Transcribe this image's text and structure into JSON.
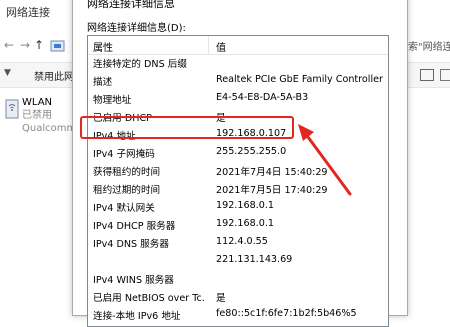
{
  "explorer": {
    "title": "网络连接",
    "nav": {
      "back": "←",
      "forward": "→",
      "up": "↑"
    },
    "search_placeholder": "搜索\"网络连",
    "toolbar": {
      "disable_label": "禁用此网",
      "left_chevron": "▼",
      "right_chevron": "»"
    },
    "adapter": {
      "name": "WLAN",
      "status": "已禁用",
      "device": "Qualcomm"
    }
  },
  "dialog": {
    "title": "网络连接详细信息",
    "section_label": "网络连接详细信息(D):",
    "columns": {
      "property": "属性",
      "value": "值"
    },
    "rows": [
      {
        "property": "连接特定的 DNS 后缀",
        "value": ""
      },
      {
        "property": "描述",
        "value": "Realtek PCIe GbE Family Controller"
      },
      {
        "property": "物理地址",
        "value": "E4-54-E8-DA-5A-B3"
      },
      {
        "property": "已启用 DHCP",
        "value": "是"
      },
      {
        "property": "IPv4 地址",
        "value": "192.168.0.107"
      },
      {
        "property": "IPv4 子网掩码",
        "value": "255.255.255.0"
      },
      {
        "property": "获得租约的时间",
        "value": "2021年7月4日 15:40:29"
      },
      {
        "property": "租约过期的时间",
        "value": "2021年7月5日 17:40:29"
      },
      {
        "property": "IPv4 默认网关",
        "value": "192.168.0.1"
      },
      {
        "property": "IPv4 DHCP 服务器",
        "value": "192.168.0.1"
      },
      {
        "property": "IPv4 DNS 服务器",
        "value": "112.4.0.55"
      },
      {
        "property": "",
        "value": "221.131.143.69"
      },
      {
        "property": "IPv4 WINS 服务器",
        "value": ""
      },
      {
        "property": "已启用 NetBIOS over Tc...",
        "value": "是"
      },
      {
        "property": "连接-本地 IPv6 地址",
        "value": "fe80::5c1f:6fe7:1b2f:5b46%5"
      }
    ]
  },
  "annotation": {
    "color": "#e2271e"
  }
}
